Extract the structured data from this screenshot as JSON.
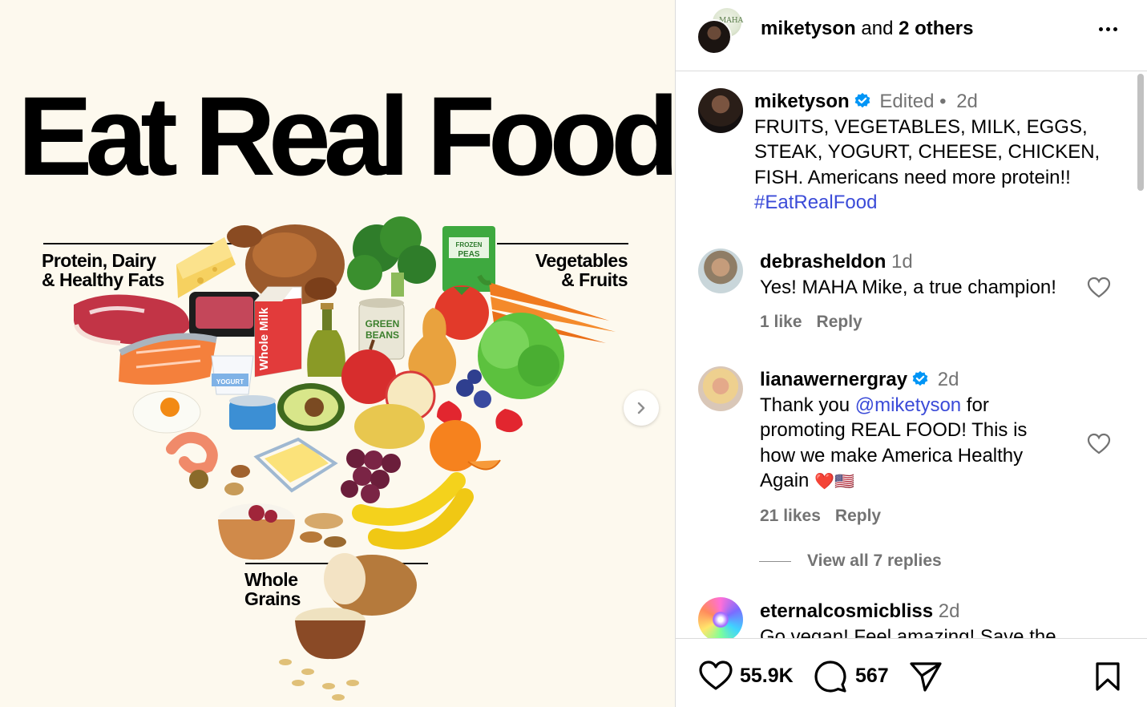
{
  "post_image": {
    "headline": "Eat Real Food",
    "group_left": [
      "Protein, Dairy",
      "& Healthy Fats"
    ],
    "group_right": [
      "Vegetables",
      "& Fruits"
    ],
    "group_bottom": [
      "Whole",
      "Grains"
    ],
    "labels": {
      "frozen_peas": [
        "FROZEN",
        "PEAS"
      ],
      "green_beans": [
        "GREEN",
        "BEANS"
      ],
      "whole_milk": "Whole Milk",
      "yogurt": "YOGURT"
    },
    "next_icon": "chevron-right-icon"
  },
  "header": {
    "username": "miketyson",
    "joiner": " and ",
    "others": "2 others",
    "more_icon": "more-horizontal-icon"
  },
  "caption": {
    "username": "miketyson",
    "edited": "Edited",
    "dot": " • ",
    "age": "2d",
    "lines": [
      "FRUITS, VEGETABLES, MILK, EGGS,",
      "STEAK, YOGURT, CHEESE, CHICKEN,",
      "FISH. Americans need more protein!!"
    ],
    "hashtag": "#EatRealFood"
  },
  "comments": [
    {
      "username": "debrasheldon",
      "age": "1d",
      "text": "Yes! MAHA Mike, a true champion!",
      "likes": "1 like",
      "reply": "Reply"
    },
    {
      "username": "lianawernergray",
      "age": "2d",
      "text_pre": "Thank you ",
      "mention": "@miketyson",
      "text_post": " for",
      "lines": [
        "promoting REAL FOOD! This is",
        "how we make America Healthy",
        "Again"
      ],
      "emoji": "❤️🇺🇸",
      "likes": "21 likes",
      "reply": "Reply",
      "view_replies": "View all 7 replies"
    },
    {
      "username": "eternalcosmicbliss",
      "age": "2d",
      "text": "Go vegan! Feel amazing! Save the"
    }
  ],
  "action_bar": {
    "likes": "55.9K",
    "comments": "567",
    "like_icon": "heart-icon",
    "comment_icon": "comment-icon",
    "share_icon": "send-icon",
    "save_icon": "bookmark-icon"
  },
  "colors": {
    "link": "#3b4bd8",
    "verified": "#0095f6",
    "muted": "#737373",
    "poster_bg": "#fdf9ee"
  }
}
